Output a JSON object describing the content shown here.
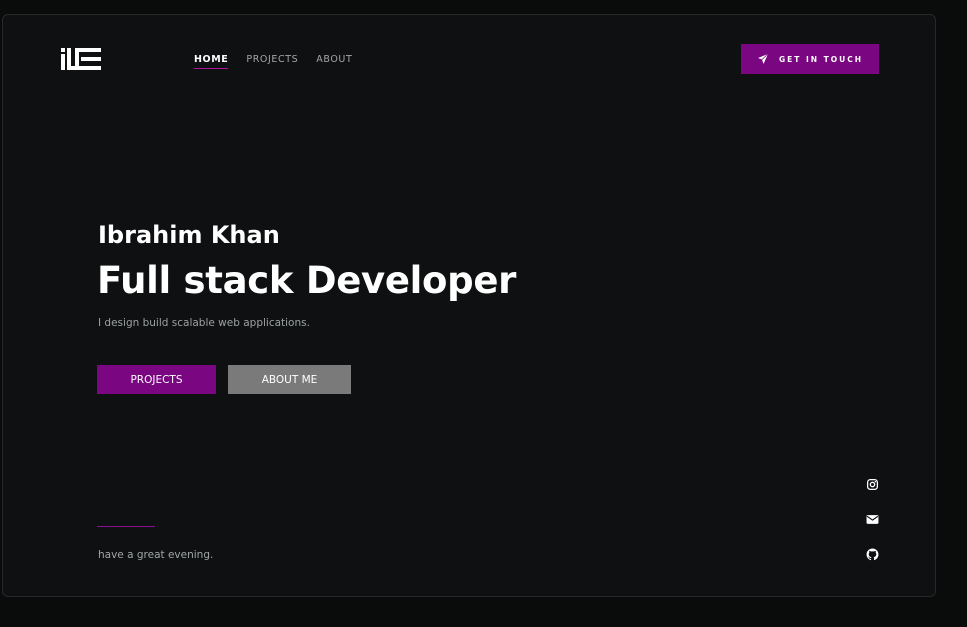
{
  "brand": {
    "logo_icon": "iE-monogram-logo",
    "accent_color": "#7b0682"
  },
  "nav": {
    "items": [
      {
        "label": "HOME",
        "active": true
      },
      {
        "label": "PROJECTS",
        "active": false
      },
      {
        "label": "ABOUT",
        "active": false
      }
    ]
  },
  "header": {
    "cta_label": "GET IN TOUCH",
    "cta_icon": "paper-plane-icon"
  },
  "hero": {
    "name": "Ibrahim Khan",
    "role": "Full stack Developer",
    "tagline": "I design build scalable web applications.",
    "primary_button": "PROJECTS",
    "secondary_button": "ABOUT ME"
  },
  "footer": {
    "greeting": "have a great evening."
  },
  "social": {
    "icons": [
      "instagram-icon",
      "mail-icon",
      "github-icon"
    ]
  }
}
